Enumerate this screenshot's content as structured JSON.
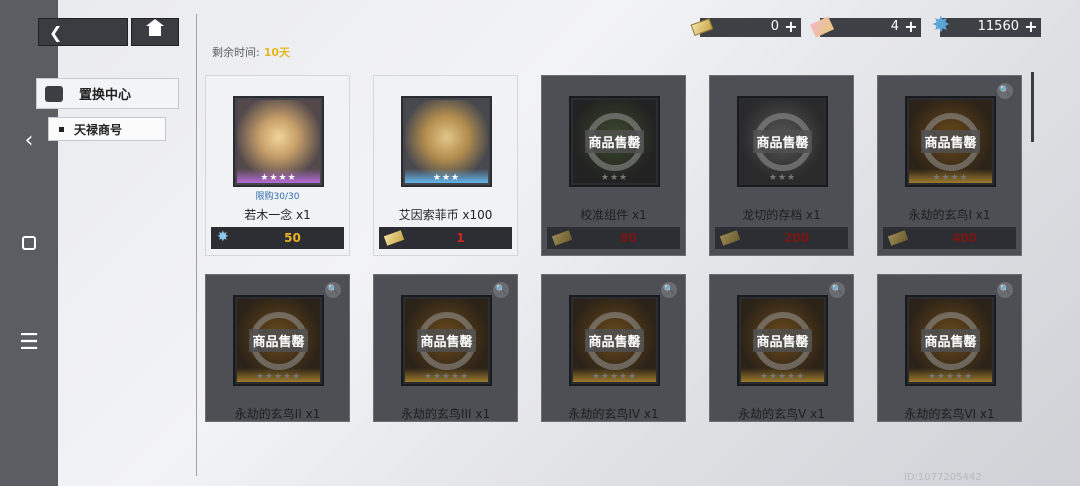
{
  "header": {
    "remaining_label": "剩余时间:",
    "remaining_value": "10天"
  },
  "currencies": [
    {
      "icon": "ticket-icon",
      "value": "0"
    },
    {
      "icon": "pink-ticket-icon",
      "value": "4"
    },
    {
      "icon": "crystal-star-icon",
      "value": "11560"
    }
  ],
  "menu": {
    "main_label": "置换中心",
    "sub_label": "天禄商号"
  },
  "sold_text": "商品售罄",
  "items": [
    {
      "name": "若木一念 x1",
      "limit": "限购30/30",
      "price": "50",
      "stars": "★★★★",
      "sold": false
    },
    {
      "name": "艾因索菲币 x100",
      "price": "1",
      "stars": "★★★",
      "sold": false
    },
    {
      "name": "校准组件 x1",
      "price": "80",
      "stars": "★★★",
      "sold": true
    },
    {
      "name": "龙切的存档 x1",
      "price": "200",
      "stars": "★★★",
      "sold": true
    },
    {
      "name": "永劫的玄鸟I x1",
      "price": "400",
      "stars": "★★★★",
      "sold": true
    },
    {
      "name": "永劫的玄鸟II x1",
      "stars": "★★★★★",
      "sold": true
    },
    {
      "name": "永劫的玄鸟III x1",
      "stars": "★★★★★",
      "sold": true
    },
    {
      "name": "永劫的玄鸟IV x1",
      "stars": "★★★★★",
      "sold": true
    },
    {
      "name": "永劫的玄鸟V x1",
      "stars": "★★★★★",
      "sold": true
    },
    {
      "name": "永劫的玄鸟VI x1",
      "stars": "★★★★★",
      "sold": true
    }
  ],
  "footer": {
    "id_text": "ID:1077205442"
  },
  "colors": {
    "accent_yellow": "#e3b71d",
    "price_gold": "#e8b321",
    "price_red": "#d2241f"
  }
}
